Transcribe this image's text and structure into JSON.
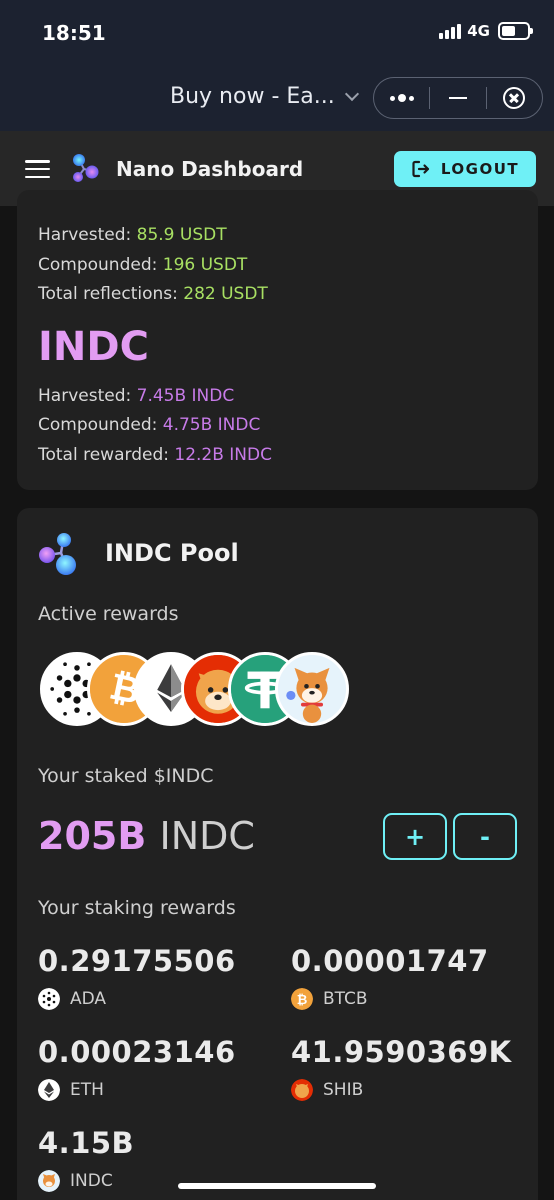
{
  "status_bar": {
    "time": "18:51",
    "network": "4G",
    "battery_level": 0.55
  },
  "browser": {
    "page_title": "Buy now - Ea..."
  },
  "header": {
    "app_title": "Nano Dashboard",
    "logout_label": "LOGOUT"
  },
  "summary": {
    "usdt": [
      {
        "label": "Harvested:",
        "value": "85.9 USDT"
      },
      {
        "label": "Compounded:",
        "value": "196 USDT"
      },
      {
        "label": "Total reflections:",
        "value": "282 USDT"
      }
    ],
    "indc_heading": "INDC",
    "indc": [
      {
        "label": "Harvested:",
        "value": "7.45B INDC"
      },
      {
        "label": "Compounded:",
        "value": "4.75B INDC"
      },
      {
        "label": "Total rewarded:",
        "value": "12.2B INDC"
      }
    ]
  },
  "pool": {
    "title": "INDC Pool",
    "active_rewards_label": "Active rewards",
    "active_reward_icons": [
      "ada-icon",
      "btcb-icon",
      "eth-icon",
      "shib-icon",
      "usdt-icon",
      "indc-dog-icon"
    ],
    "staked_label": "Your staked $INDC",
    "staked_value": "205B",
    "staked_unit": "INDC",
    "add_label": "+",
    "remove_label": "-",
    "staking_rewards_label": "Your staking rewards",
    "rewards": [
      {
        "value": "0.29175506",
        "token": "ADA",
        "icon": "ada-icon"
      },
      {
        "value": "0.00001747",
        "token": "BTCB",
        "icon": "btcb-icon"
      },
      {
        "value": "0.00023146",
        "token": "ETH",
        "icon": "eth-icon"
      },
      {
        "value": "41.9590369K",
        "token": "SHIB",
        "icon": "shib-icon"
      },
      {
        "value": "4.15B",
        "token": "INDC",
        "icon": "indc-dog-icon"
      }
    ]
  },
  "colors": {
    "accent_cyan": "#6ff0f6",
    "usdt_value_green": "#a8e063",
    "indc_purple": "#c77be8",
    "card_bg": "#212121",
    "page_bg": "#141414"
  }
}
